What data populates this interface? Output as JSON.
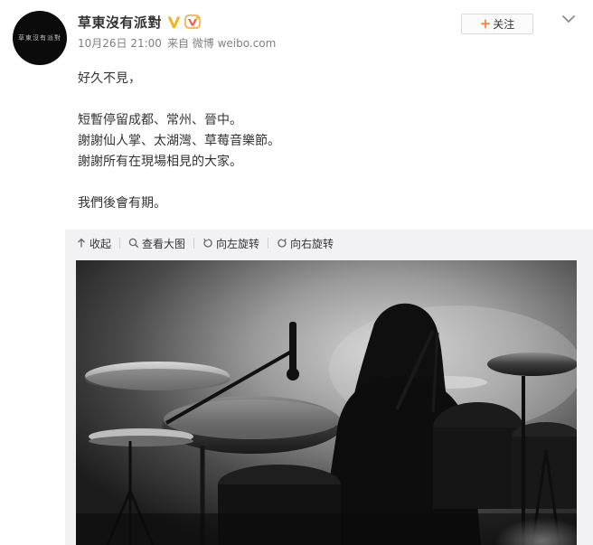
{
  "user": {
    "avatar_text": "草東沒有派對",
    "name": "草東沒有派對",
    "verified_icon": "verified-v-icon",
    "member_icon": "member-badge-icon"
  },
  "meta": {
    "time": "10月26日 21:00",
    "source_prefix": "来自",
    "source": "微博 weibo.com"
  },
  "follow": {
    "label": "关注"
  },
  "post": {
    "line1": "好久不見，",
    "line2": "短暫停留成都、常州、晉中。",
    "line3": "謝謝仙人掌、太湖灣、草莓音樂節。",
    "line4": "謝謝所有在現場相見的大家。",
    "line5": "我們後會有期。"
  },
  "toolbar": {
    "collapse": "收起",
    "view_large": "查看大图",
    "rotate_left": "向左旋转",
    "rotate_right": "向右旋转"
  },
  "colors": {
    "text": "#333333",
    "meta": "#808080",
    "accent_orange": "#ff8140",
    "verified_gold": "#f6b31a",
    "panel_bg": "#f2f2f5"
  }
}
